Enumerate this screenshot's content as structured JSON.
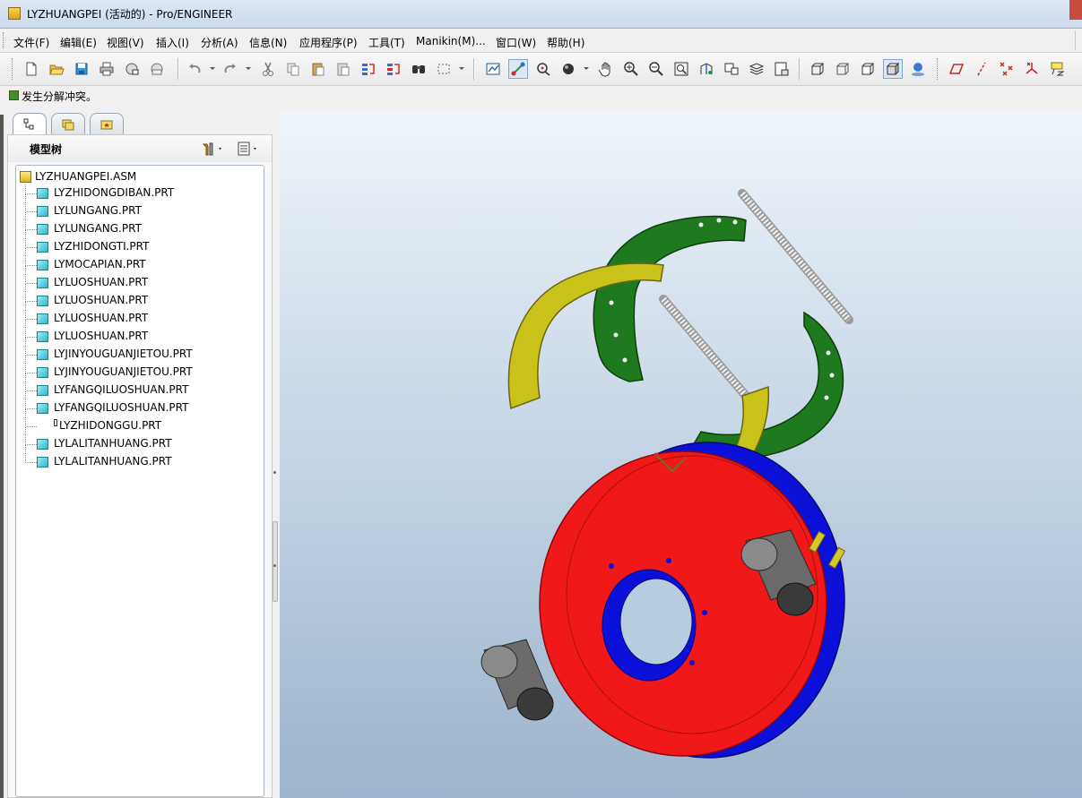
{
  "window": {
    "title": "LYZHUANGPEI (活动的) - Pro/ENGINEER"
  },
  "menu": {
    "items": [
      "文件(F)",
      "编辑(E)",
      "视图(V)",
      "插入(I)",
      "分析(A)",
      "信息(N)",
      "应用程序(P)",
      "工具(T)",
      "Manikin(M)...",
      "窗口(W)",
      "帮助(H)"
    ]
  },
  "toolbar": {
    "buttons": [
      {
        "name": "new-icon"
      },
      {
        "name": "open-icon"
      },
      {
        "name": "save-icon"
      },
      {
        "name": "print-icon"
      },
      {
        "name": "send-mail-icon"
      },
      {
        "name": "send-mail-link-icon"
      },
      {
        "name": "undo-icon"
      },
      {
        "name": "redo-icon"
      },
      {
        "name": "cut-icon"
      },
      {
        "name": "copy-icon"
      },
      {
        "name": "paste-icon"
      },
      {
        "name": "paste-special-icon"
      },
      {
        "name": "regenerate-icon"
      },
      {
        "name": "regen-manager-icon"
      },
      {
        "name": "find-icon"
      },
      {
        "name": "select-box-icon"
      },
      {
        "name": "repaint-icon"
      },
      {
        "name": "spin-center-icon"
      },
      {
        "name": "orient-mode-icon"
      },
      {
        "name": "appearance-icon"
      },
      {
        "name": "pan-icon"
      },
      {
        "name": "zoom-in-icon"
      },
      {
        "name": "zoom-out-icon"
      },
      {
        "name": "refit-icon"
      },
      {
        "name": "reorient-icon"
      },
      {
        "name": "saved-views-icon"
      },
      {
        "name": "layers-icon"
      },
      {
        "name": "view-manager-icon"
      },
      {
        "name": "wireframe-icon"
      },
      {
        "name": "hidden-line-icon"
      },
      {
        "name": "no-hidden-icon"
      },
      {
        "name": "shading-icon"
      },
      {
        "name": "enhanced-realism-icon"
      },
      {
        "name": "datum-planes-icon"
      },
      {
        "name": "datum-axes-icon"
      },
      {
        "name": "datum-points-icon"
      },
      {
        "name": "coord-sys-icon"
      },
      {
        "name": "annotations-icon"
      }
    ]
  },
  "message": {
    "text": "发生分解冲突。"
  },
  "navigator": {
    "tabs": [
      "model-tree-tab",
      "layer-tree-tab",
      "favorites-tab"
    ]
  },
  "model_tree": {
    "title": "模型树",
    "root": "LYZHUANGPEI.ASM",
    "items": [
      {
        "label": "LYZHIDONGDIBAN.PRT"
      },
      {
        "label": "LYLUNGANG.PRT"
      },
      {
        "label": "LYLUNGANG.PRT"
      },
      {
        "label": "LYZHIDONGTI.PRT"
      },
      {
        "label": "LYMOCAPIAN.PRT"
      },
      {
        "label": "LYLUOSHUAN.PRT"
      },
      {
        "label": "LYLUOSHUAN.PRT"
      },
      {
        "label": "LYLUOSHUAN.PRT"
      },
      {
        "label": "LYLUOSHUAN.PRT"
      },
      {
        "label": "LYJINYOUGUANJIETOU.PRT"
      },
      {
        "label": "LYJINYOUGUANJIETOU.PRT"
      },
      {
        "label": "LYFANGQILUOSHUAN.PRT"
      },
      {
        "label": "LYFANGQILUOSHUAN.PRT"
      },
      {
        "label": "LYZHIDONGGU.PRT",
        "icon": "blank-part-icon"
      },
      {
        "label": "LYLALITANHUANG.PRT"
      },
      {
        "label": "LYLALITANHUANG.PRT"
      }
    ]
  },
  "colors": {
    "drum_red": "#f01818",
    "backplate_blue": "#0a10d8",
    "shoe_green": "#1f7a1f",
    "lining_yellow": "#c8c21a",
    "cylinder_gray": "#6a6a6a",
    "spring_white": "#e8e8e8",
    "viewport_top": "#eef4fa",
    "viewport_bottom": "#9db4cc"
  }
}
